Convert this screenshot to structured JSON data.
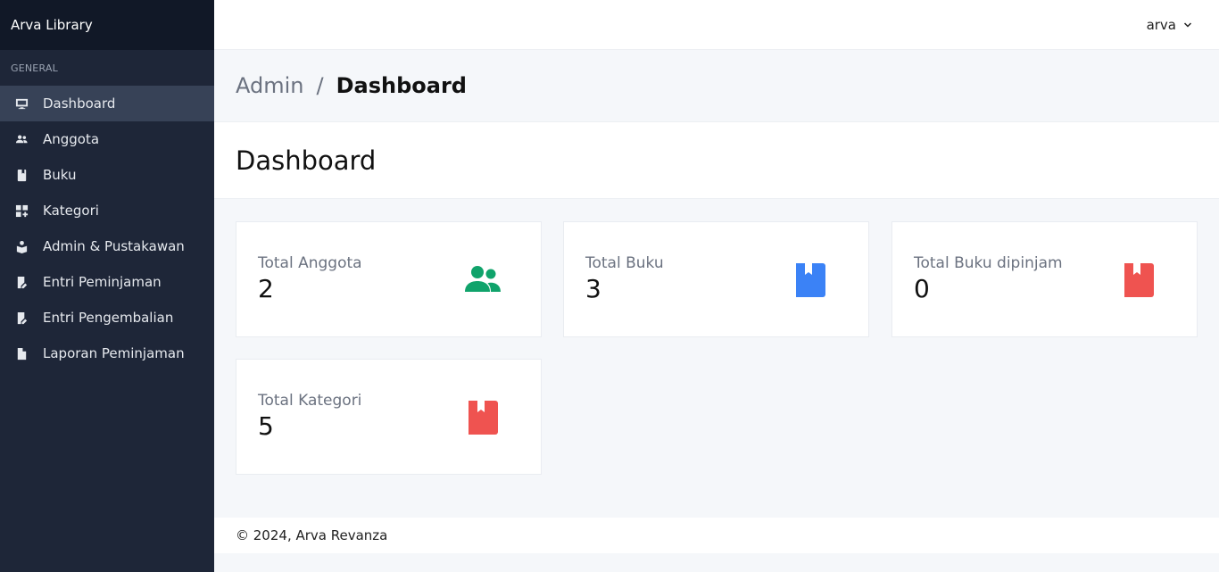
{
  "sidebar": {
    "brand": "Arva Library",
    "section_label": "GENERAL",
    "items": [
      {
        "label": "Dashboard",
        "icon": "monitor-icon"
      },
      {
        "label": "Anggota",
        "icon": "users-icon"
      },
      {
        "label": "Buku",
        "icon": "book-icon"
      },
      {
        "label": "Kategori",
        "icon": "category-icon"
      },
      {
        "label": "Admin & Pustakawan",
        "icon": "book-reader-icon"
      },
      {
        "label": "Entri Peminjaman",
        "icon": "book-edit-icon"
      },
      {
        "label": "Entri Pengembalian",
        "icon": "book-edit-icon"
      },
      {
        "label": "Laporan Peminjaman",
        "icon": "file-icon"
      }
    ],
    "active_item": "Dashboard"
  },
  "topbar": {
    "username": "arva"
  },
  "breadcrumb": {
    "root": "Admin",
    "separator": "/",
    "current": "Dashboard"
  },
  "page": {
    "title": "Dashboard"
  },
  "cards": [
    {
      "label": "Total Anggota",
      "value": "2",
      "icon": "users-icon",
      "color": "#10a36b"
    },
    {
      "label": "Total Buku",
      "value": "3",
      "icon": "bookmark-book-icon",
      "color": "#3b82f6"
    },
    {
      "label": "Total Buku dipinjam",
      "value": "0",
      "icon": "bookmark-book-icon",
      "color": "#ef5350"
    },
    {
      "label": "Total Kategori",
      "value": "5",
      "icon": "bookmark-book-icon",
      "color": "#ef5350"
    }
  ],
  "footer": {
    "text": "© 2024, Arva Revanza"
  }
}
